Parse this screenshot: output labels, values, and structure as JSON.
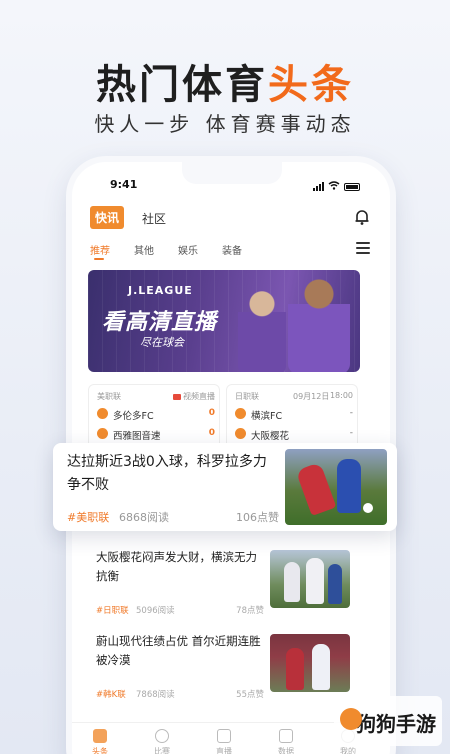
{
  "promo": {
    "headline_main": "热门体育",
    "headline_accent": "头条",
    "subline": "快人一步  体育赛事动态"
  },
  "status_bar": {
    "time": "9:41"
  },
  "top_nav": {
    "tabs": [
      "快讯",
      "社区"
    ]
  },
  "sub_tabs": [
    "推荐",
    "其他",
    "娱乐",
    "装备"
  ],
  "banner": {
    "logo_text": "J.LEAGUE",
    "title": "看高清直播",
    "subtitle": "尽在球会"
  },
  "score_cards": [
    {
      "league": "美职联",
      "status": "视频直播",
      "teams": [
        {
          "name": "多伦多FC",
          "score": "0"
        },
        {
          "name": "西雅图音速",
          "score": "0"
        }
      ]
    },
    {
      "league": "日职联",
      "date": "09月12日",
      "time": "18:00",
      "teams": [
        {
          "name": "横滨FC",
          "score": "-"
        },
        {
          "name": "大阪樱花",
          "score": "-"
        }
      ]
    }
  ],
  "featured_article": {
    "title": "达拉斯近3战0入球，科罗拉多力争不败",
    "tag": "#美职联",
    "reads": "6868阅读",
    "likes": "106点赞"
  },
  "articles": [
    {
      "title": "大阪樱花闷声发大财，横滨无力抗衡",
      "tag": "#日职联",
      "reads": "5096阅读",
      "likes": "78点赞"
    },
    {
      "title": "蔚山现代往绩占优 首尔近期连胜被冷漠",
      "tag": "#韩K联",
      "reads": "7868阅读",
      "likes": "55点赞"
    }
  ],
  "bottom_nav": [
    "头条",
    "比赛",
    "直播",
    "数据",
    "我的"
  ],
  "watermark": "狗狗手游",
  "colors": {
    "accent": "#f07a2a",
    "banner": "#5a3f8e"
  }
}
